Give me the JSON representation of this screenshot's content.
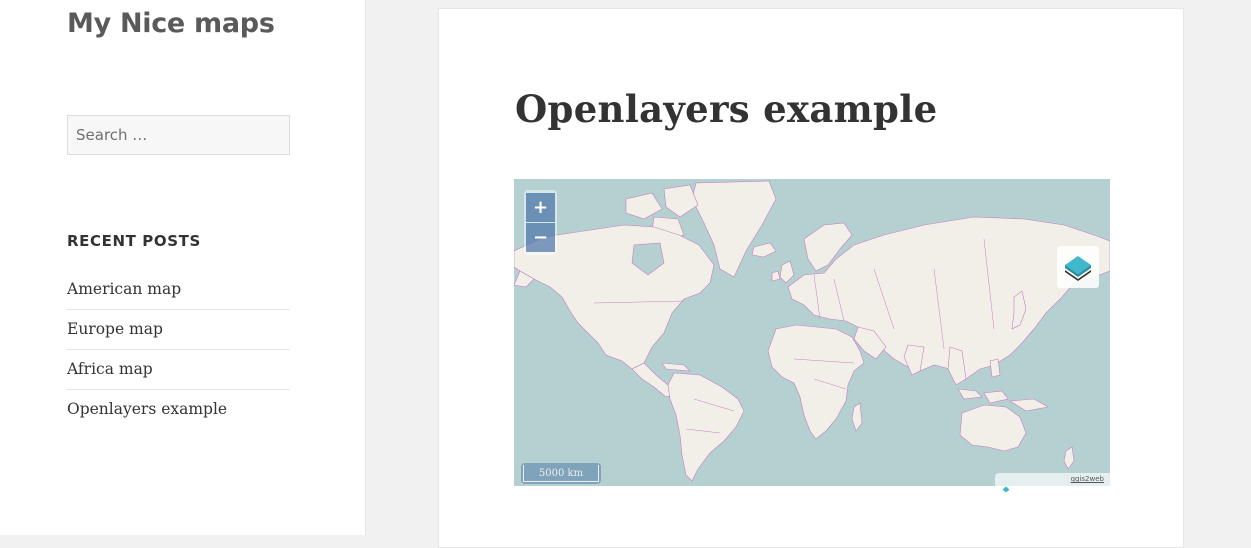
{
  "site": {
    "title": "My Nice maps"
  },
  "sidebar": {
    "search": {
      "placeholder": "Search …"
    },
    "recent_posts": {
      "heading": "RECENT POSTS",
      "items": [
        {
          "label": "American map"
        },
        {
          "label": "Europe map"
        },
        {
          "label": "Africa map"
        },
        {
          "label": "Openlayers example"
        }
      ]
    }
  },
  "main": {
    "title": "Openlayers example",
    "map": {
      "zoom_in": "+",
      "zoom_out": "−",
      "scale": "5000 km",
      "attribution": "qgis2web",
      "layer_switcher_icon": "layers-icon",
      "colors": {
        "water": "#b5d0d0",
        "land": "#f2efe9",
        "border": "#c77fc0",
        "control": "#7a9ec4",
        "layers_icon": "#3fb8cc"
      }
    }
  }
}
